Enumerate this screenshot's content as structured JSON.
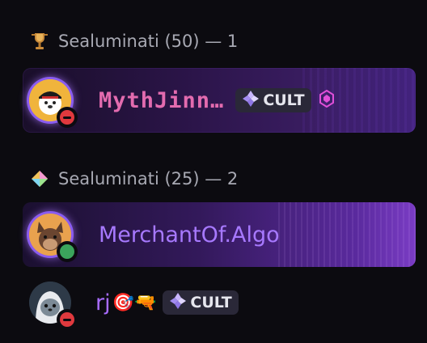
{
  "sections": [
    {
      "label": "Sealuminati (50) — 1",
      "icon": "trophy-icon"
    },
    {
      "label": "Sealuminati (25) — 2",
      "icon": "diamond-icon"
    }
  ],
  "members": [
    {
      "name": "MythJinn…",
      "tag": "CULT",
      "status": "dnd",
      "badge": "nitro-boost-icon"
    },
    {
      "name": "MerchantOf.Algo",
      "status": "online"
    },
    {
      "name": "rj",
      "emoji": "🎯🔫",
      "tag": "CULT",
      "status": "dnd"
    }
  ],
  "colors": {
    "accent": "#a779ff",
    "pixel_name": "#e36baf",
    "dnd": "#e0393e",
    "online": "#3ba55c"
  }
}
